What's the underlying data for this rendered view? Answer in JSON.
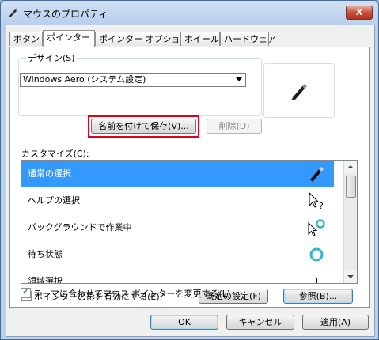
{
  "window": {
    "title": "マウスのプロパティ",
    "close_label": "X"
  },
  "tabs": [
    "ボタン",
    "ポインター",
    "ポインター オプション",
    "ホイール",
    "ハードウェア"
  ],
  "active_tab": "ポインター",
  "design": {
    "label": "デザイン(S)",
    "scheme_value": "Windows Aero (システム設定)",
    "save_as_label": "名前を付けて保存(V)...",
    "delete_label": "削除(D)"
  },
  "customize": {
    "label": "カスタマイズ(C):",
    "items": [
      {
        "label": "通常の選択",
        "icon": "pen-cursor-icon"
      },
      {
        "label": "ヘルプの選択",
        "icon": "help-select-cursor-icon"
      },
      {
        "label": "バックグラウンドで作業中",
        "icon": "working-background-cursor-icon"
      },
      {
        "label": "待ち状態",
        "icon": "busy-cursor-icon"
      },
      {
        "label": "領域選択",
        "icon": "precision-select-cursor-icon"
      }
    ],
    "selected_index": 0
  },
  "options": {
    "enable_shadow_label": "ポインターの影を有効にする(E)",
    "enable_shadow_checked": true,
    "allow_theme_change_label": "テーマに合わせてマウス ポインターを変更する(L)",
    "allow_theme_change_checked": true,
    "use_default_label": "既定の設定(F)",
    "browse_label": "参照(B)..."
  },
  "footer": {
    "ok": "OK",
    "cancel": "キャンセル",
    "apply": "適用(A)"
  },
  "colors": {
    "selection": "#3399ff",
    "highlight_box": "#e0001b"
  }
}
